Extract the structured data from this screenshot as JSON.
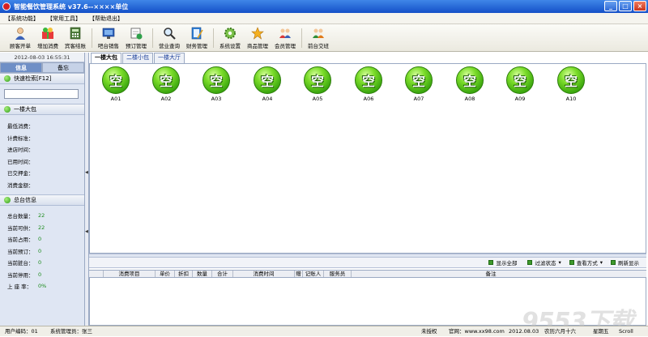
{
  "window": {
    "title": "智能餐饮管理系统 v37.6--××××单位",
    "min_symbol": "_",
    "max_symbol": "□",
    "close_symbol": "×"
  },
  "menu": [
    "【系统功能】",
    "【常用工具】",
    "【帮助退出】"
  ],
  "toolbar": {
    "buttons": [
      {
        "label": "顾客开单",
        "icon": "customer-icon"
      },
      {
        "label": "增加消费",
        "icon": "gift-box-icon"
      },
      {
        "label": "宾客结账",
        "icon": "calculator-icon"
      },
      {
        "label": "吧台销售",
        "icon": "monitor-icon"
      },
      {
        "label": "预订管理",
        "icon": "calendar-refresh-icon"
      },
      {
        "label": "营业查询",
        "icon": "magnifier-icon"
      },
      {
        "label": "财务管理",
        "icon": "notebook-pen-icon"
      },
      {
        "label": "系统设置",
        "icon": "gear-icon"
      },
      {
        "label": "商品管理",
        "icon": "star-icon"
      },
      {
        "label": "会员管理",
        "icon": "members-icon"
      },
      {
        "label": "前台交班",
        "icon": "handover-icon"
      }
    ]
  },
  "left": {
    "datetime": "2012-08-03 16:55:31",
    "tabs": [
      "信息",
      "备忘"
    ],
    "quick_search": "快速检索[F12]",
    "room_name": "一楼大包",
    "info_rows": [
      "最低消费：",
      "计费标准：",
      "进店时间：",
      "已用时间：",
      "已交押金：",
      "消费金额："
    ],
    "summary_title": "总台信息",
    "stats": [
      {
        "label": "总台数量：",
        "value": "22"
      },
      {
        "label": "当前可供：",
        "value": "22"
      },
      {
        "label": "当前占用：",
        "value": "0"
      },
      {
        "label": "当前预订：",
        "value": "0"
      },
      {
        "label": "当前脏台：",
        "value": "0"
      },
      {
        "label": "当前停用：",
        "value": "0"
      },
      {
        "label": "上 座 率：",
        "value": "0%"
      }
    ]
  },
  "main": {
    "tabs": [
      "一楼大包",
      "二楼小包",
      "一楼大厅"
    ],
    "tables": [
      {
        "status": "空",
        "name": "A01"
      },
      {
        "status": "空",
        "name": "A02"
      },
      {
        "status": "空",
        "name": "A03"
      },
      {
        "status": "空",
        "name": "A04"
      },
      {
        "status": "空",
        "name": "A05"
      },
      {
        "status": "空",
        "name": "A06"
      },
      {
        "status": "空",
        "name": "A07"
      },
      {
        "status": "空",
        "name": "A08"
      },
      {
        "status": "空",
        "name": "A09"
      },
      {
        "status": "空",
        "name": "A10"
      }
    ],
    "filters": [
      "显示全部",
      "过滤状态",
      "查看方式",
      "刷新显示"
    ],
    "filter_arrows": [
      "",
      "▾",
      "▾",
      ""
    ],
    "columns": [
      "",
      "消费项目",
      "单价",
      "折扣",
      "数量",
      "合计",
      "消费时间",
      "赠",
      "记账人",
      "服务员",
      "备注"
    ]
  },
  "status": {
    "user_code": "用户编码：01",
    "admin": "系统管理员：张三",
    "license": "未授权",
    "website": "官网：www.xx98.com",
    "date": "2012.08.03",
    "lunar": "农历六月十六",
    "weekday": "星期五",
    "extra": "Scroll"
  },
  "watermark": "9553下载"
}
